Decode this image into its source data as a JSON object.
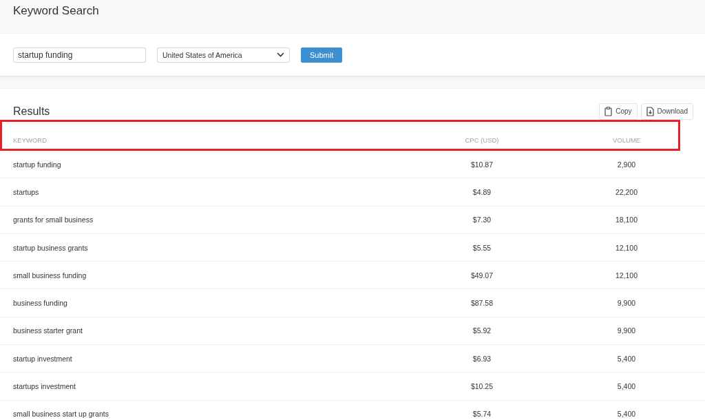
{
  "page_title": "Keyword Search",
  "search": {
    "query": "startup funding",
    "country": "United States of America",
    "submit": "Submit"
  },
  "results": {
    "title": "Results",
    "actions": [
      {
        "kind": "copy",
        "label": "Copy"
      },
      {
        "kind": "download",
        "label": "Download"
      }
    ],
    "table": {
      "header_highlighted": true,
      "columns": [
        "KEYWORD",
        "CPC (USD)",
        "VOLUME"
      ],
      "rows": [
        [
          "startup funding",
          "$10.87",
          "2,900"
        ],
        [
          "startups",
          "$4.89",
          "22,200"
        ],
        [
          "grants for small business",
          "$7.30",
          "18,100"
        ],
        [
          "startup business grants",
          "$5.55",
          "12,100"
        ],
        [
          "small business funding",
          "$49.07",
          "12,100"
        ],
        [
          "business funding",
          "$87.58",
          "9,900"
        ],
        [
          "business starter grant",
          "$5.92",
          "9,900"
        ],
        [
          "startup investment",
          "$6.93",
          "5,400"
        ],
        [
          "startups investment",
          "$10.25",
          "5,400"
        ],
        [
          "small business start up grants",
          "$5.74",
          "5,400"
        ]
      ]
    }
  }
}
